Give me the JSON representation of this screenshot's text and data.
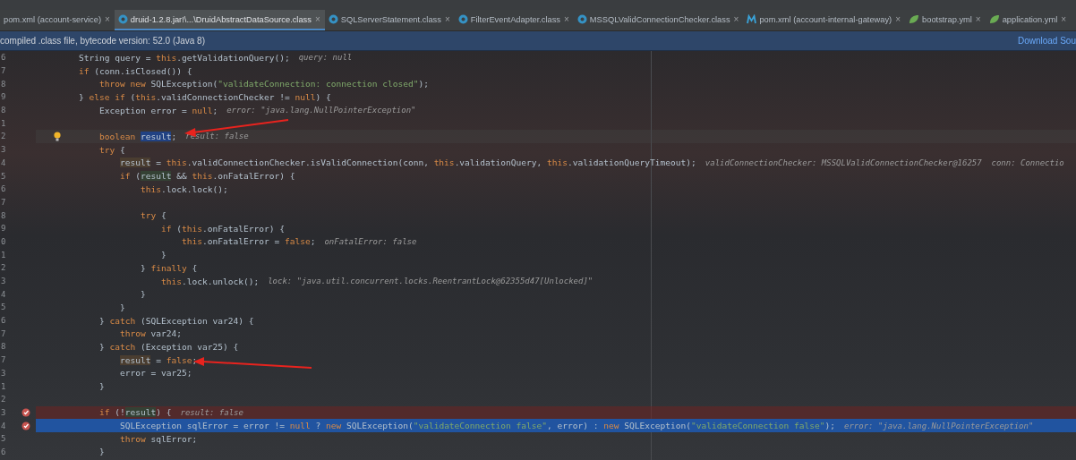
{
  "tabs": [
    {
      "label": "pom.xml (account-service)",
      "kind": "plain",
      "close": "×",
      "selected": false
    },
    {
      "label": "druid-1.2.8.jar!\\...\\DruidAbstractDataSource.class",
      "kind": "class",
      "close": "×",
      "selected": true
    },
    {
      "label": "SQLServerStatement.class",
      "kind": "class",
      "close": "×",
      "selected": false
    },
    {
      "label": "FilterEventAdapter.class",
      "kind": "class",
      "close": "×",
      "selected": false
    },
    {
      "label": "MSSQLValidConnectionChecker.class",
      "kind": "class",
      "close": "×",
      "selected": false
    },
    {
      "label": "pom.xml (account-internal-gateway)",
      "kind": "maven",
      "close": "×",
      "selected": false
    },
    {
      "label": "bootstrap.yml",
      "kind": "yml",
      "close": "×",
      "selected": false
    },
    {
      "label": "application.yml",
      "kind": "yml",
      "close": "×",
      "selected": false
    }
  ],
  "banner": {
    "text": "compiled .class file, bytecode version: 52.0 (Java 8)",
    "link": "Download Sou"
  },
  "lines": [
    {
      "no": "6",
      "kind": "code",
      "segments": [
        {
          "kind": "plain",
          "text": "String query = "
        },
        {
          "kind": "keyword",
          "text": "this"
        },
        {
          "kind": "plain",
          "text": ".getValidationQuery();"
        },
        {
          "kind": "hint",
          "text": "query: null"
        }
      ]
    },
    {
      "no": "7",
      "kind": "code",
      "segments": [
        {
          "kind": "keyword",
          "text": "if "
        },
        {
          "kind": "plain",
          "text": "(conn.isClosed()) {"
        }
      ]
    },
    {
      "no": "8",
      "kind": "code",
      "segments": [
        {
          "kind": "keyword",
          "text": "    throw new "
        },
        {
          "kind": "plain",
          "text": "SQLException("
        },
        {
          "kind": "string",
          "text": "\"validateConnection: connection closed\""
        },
        {
          "kind": "plain",
          "text": ");"
        }
      ]
    },
    {
      "no": "9",
      "kind": "code",
      "segments": [
        {
          "kind": "plain",
          "text": "} "
        },
        {
          "kind": "keyword",
          "text": "else if "
        },
        {
          "kind": "plain",
          "text": "("
        },
        {
          "kind": "keyword",
          "text": "this"
        },
        {
          "kind": "plain",
          "text": ".validConnectionChecker != "
        },
        {
          "kind": "keyword",
          "text": "null"
        },
        {
          "kind": "plain",
          "text": ") {"
        }
      ]
    },
    {
      "no": "8",
      "kind": "code",
      "segments": [
        {
          "kind": "plain",
          "text": "    Exception error = "
        },
        {
          "kind": "keyword",
          "text": "null"
        },
        {
          "kind": "plain",
          "text": ";"
        },
        {
          "kind": "hint",
          "text": "error: \"java.lang.NullPointerException\""
        }
      ]
    },
    {
      "no": "1",
      "kind": "code"
    },
    {
      "no": "2",
      "kind": "caret",
      "segments": [
        {
          "kind": "keyword",
          "text": "    boolean "
        },
        {
          "kind": "selected",
          "text": "result"
        },
        {
          "kind": "plain",
          "text": ";"
        },
        {
          "kind": "hint",
          "text": "result: false"
        }
      ]
    },
    {
      "no": "3",
      "kind": "code",
      "segments": [
        {
          "kind": "keyword",
          "text": "    try "
        },
        {
          "kind": "plain",
          "text": "{"
        }
      ]
    },
    {
      "no": "4",
      "kind": "code",
      "segments": [
        {
          "kind": "write",
          "text": "        result"
        },
        {
          "kind": "plain",
          "text": " = "
        },
        {
          "kind": "keyword",
          "text": "this"
        },
        {
          "kind": "plain",
          "text": ".validConnectionChecker.isValidConnection(conn, "
        },
        {
          "kind": "keyword",
          "text": "this"
        },
        {
          "kind": "plain",
          "text": ".validationQuery, "
        },
        {
          "kind": "keyword",
          "text": "this"
        },
        {
          "kind": "plain",
          "text": ".validationQueryTimeout);"
        },
        {
          "kind": "hint",
          "text": "validConnectionChecker: MSSQLValidConnectionChecker@16257  conn: Connectio"
        }
      ]
    },
    {
      "no": "5",
      "kind": "code",
      "segments": [
        {
          "kind": "keyword",
          "text": "        if "
        },
        {
          "kind": "plain",
          "text": "("
        },
        {
          "kind": "read",
          "text": "result"
        },
        {
          "kind": "plain",
          "text": " && "
        },
        {
          "kind": "keyword",
          "text": "this"
        },
        {
          "kind": "plain",
          "text": ".onFatalError) {"
        }
      ]
    },
    {
      "no": "6",
      "kind": "code",
      "segments": [
        {
          "kind": "keyword",
          "text": "            this"
        },
        {
          "kind": "plain",
          "text": ".lock.lock();"
        }
      ]
    },
    {
      "no": "7",
      "kind": "code"
    },
    {
      "no": "8",
      "kind": "code",
      "segments": [
        {
          "kind": "keyword",
          "text": "            try "
        },
        {
          "kind": "plain",
          "text": "{"
        }
      ]
    },
    {
      "no": "9",
      "kind": "code",
      "segments": [
        {
          "kind": "keyword",
          "text": "                if "
        },
        {
          "kind": "plain",
          "text": "("
        },
        {
          "kind": "keyword",
          "text": "this"
        },
        {
          "kind": "plain",
          "text": ".onFatalError) {"
        }
      ]
    },
    {
      "no": "0",
      "kind": "code",
      "segments": [
        {
          "kind": "keyword",
          "text": "                    this"
        },
        {
          "kind": "plain",
          "text": ".onFatalError = "
        },
        {
          "kind": "keyword",
          "text": "false"
        },
        {
          "kind": "plain",
          "text": ";"
        },
        {
          "kind": "hint",
          "text": "onFatalError: false"
        }
      ]
    },
    {
      "no": "1",
      "kind": "code",
      "segments": [
        {
          "kind": "plain",
          "text": "                }"
        }
      ]
    },
    {
      "no": "2",
      "kind": "code",
      "segments": [
        {
          "kind": "plain",
          "text": "            } "
        },
        {
          "kind": "keyword",
          "text": "finally "
        },
        {
          "kind": "plain",
          "text": "{"
        }
      ]
    },
    {
      "no": "3",
      "kind": "code",
      "segments": [
        {
          "kind": "keyword",
          "text": "                this"
        },
        {
          "kind": "plain",
          "text": ".lock.unlock();"
        },
        {
          "kind": "hint",
          "text": "lock: \"java.util.concurrent.locks.ReentrantLock@62355d47[Unlocked]\""
        }
      ]
    },
    {
      "no": "4",
      "kind": "code",
      "segments": [
        {
          "kind": "plain",
          "text": "            }"
        }
      ]
    },
    {
      "no": "5",
      "kind": "code",
      "segments": [
        {
          "kind": "plain",
          "text": "        }"
        }
      ]
    },
    {
      "no": "6",
      "kind": "code",
      "segments": [
        {
          "kind": "plain",
          "text": "    } "
        },
        {
          "kind": "keyword",
          "text": "catch "
        },
        {
          "kind": "plain",
          "text": "(SQLException var24) {"
        }
      ]
    },
    {
      "no": "7",
      "kind": "code",
      "segments": [
        {
          "kind": "keyword",
          "text": "        throw "
        },
        {
          "kind": "plain",
          "text": "var24;"
        }
      ]
    },
    {
      "no": "8",
      "kind": "code",
      "segments": [
        {
          "kind": "plain",
          "text": "    } "
        },
        {
          "kind": "keyword",
          "text": "catch "
        },
        {
          "kind": "plain",
          "text": "(Exception var25) {"
        }
      ]
    },
    {
      "no": "7",
      "kind": "code",
      "segments": [
        {
          "kind": "write",
          "text": "        result"
        },
        {
          "kind": "plain",
          "text": " = "
        },
        {
          "kind": "keyword",
          "text": "false"
        },
        {
          "kind": "plain",
          "text": ";"
        }
      ]
    },
    {
      "no": "3",
      "kind": "code",
      "segments": [
        {
          "kind": "plain",
          "text": "        error = var25;"
        }
      ]
    },
    {
      "no": "1",
      "kind": "code",
      "segments": [
        {
          "kind": "plain",
          "text": "    }"
        }
      ]
    },
    {
      "no": "2",
      "kind": "code"
    },
    {
      "no": "3",
      "kind": "breakpoint",
      "segments": [
        {
          "kind": "keyword",
          "text": "    if "
        },
        {
          "kind": "plain",
          "text": "(!"
        },
        {
          "kind": "read",
          "text": "result"
        },
        {
          "kind": "plain",
          "text": ") {"
        },
        {
          "kind": "hint",
          "text": "result: false"
        }
      ]
    },
    {
      "no": "4",
      "kind": "execution",
      "segments": [
        {
          "kind": "plain",
          "text": "        SQLException sqlError = error != "
        },
        {
          "kind": "keyword",
          "text": "null"
        },
        {
          "kind": "plain",
          "text": " ? "
        },
        {
          "kind": "keyword",
          "text": "new "
        },
        {
          "kind": "plain",
          "text": "SQLException("
        },
        {
          "kind": "string",
          "text": "\"validateConnection false\""
        },
        {
          "kind": "plain",
          "text": ", error) : "
        },
        {
          "kind": "keyword",
          "text": "new "
        },
        {
          "kind": "plain",
          "text": "SQLException("
        },
        {
          "kind": "string",
          "text": "\"validateConnection false\""
        },
        {
          "kind": "plain",
          "text": ");"
        },
        {
          "kind": "hint",
          "text": "error: \"java.lang.NullPointerException\""
        }
      ]
    },
    {
      "no": "5",
      "kind": "code",
      "segments": [
        {
          "kind": "keyword",
          "text": "        throw "
        },
        {
          "kind": "plain",
          "text": "sqlError;"
        }
      ]
    },
    {
      "no": "6",
      "kind": "code",
      "segments": [
        {
          "kind": "plain",
          "text": "    }"
        }
      ]
    }
  ]
}
